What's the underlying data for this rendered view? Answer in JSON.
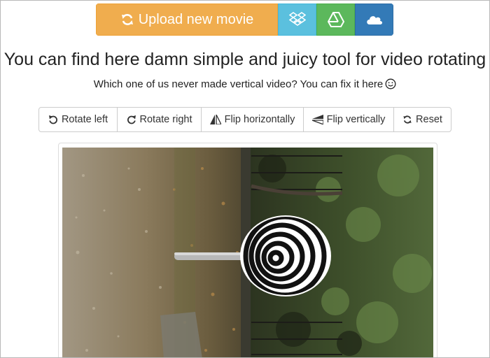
{
  "upload": {
    "label": "Upload new movie",
    "services": [
      "dropbox-icon",
      "google-drive-icon",
      "onedrive-icon"
    ]
  },
  "headline": "You can find here damn simple and juicy tool for video rotating",
  "subline": "Which one of us never made vertical video? You can fix it here",
  "toolbar": {
    "rotate_left": "Rotate left",
    "rotate_right": "Rotate right",
    "flip_horizontally": "Flip horizontally",
    "flip_vertically": "Flip vertically",
    "reset": "Reset"
  },
  "colors": {
    "upload": "#f0ad4e",
    "dropbox": "#5bc0de",
    "drive": "#5cb85c",
    "onedrive": "#337ab7"
  }
}
